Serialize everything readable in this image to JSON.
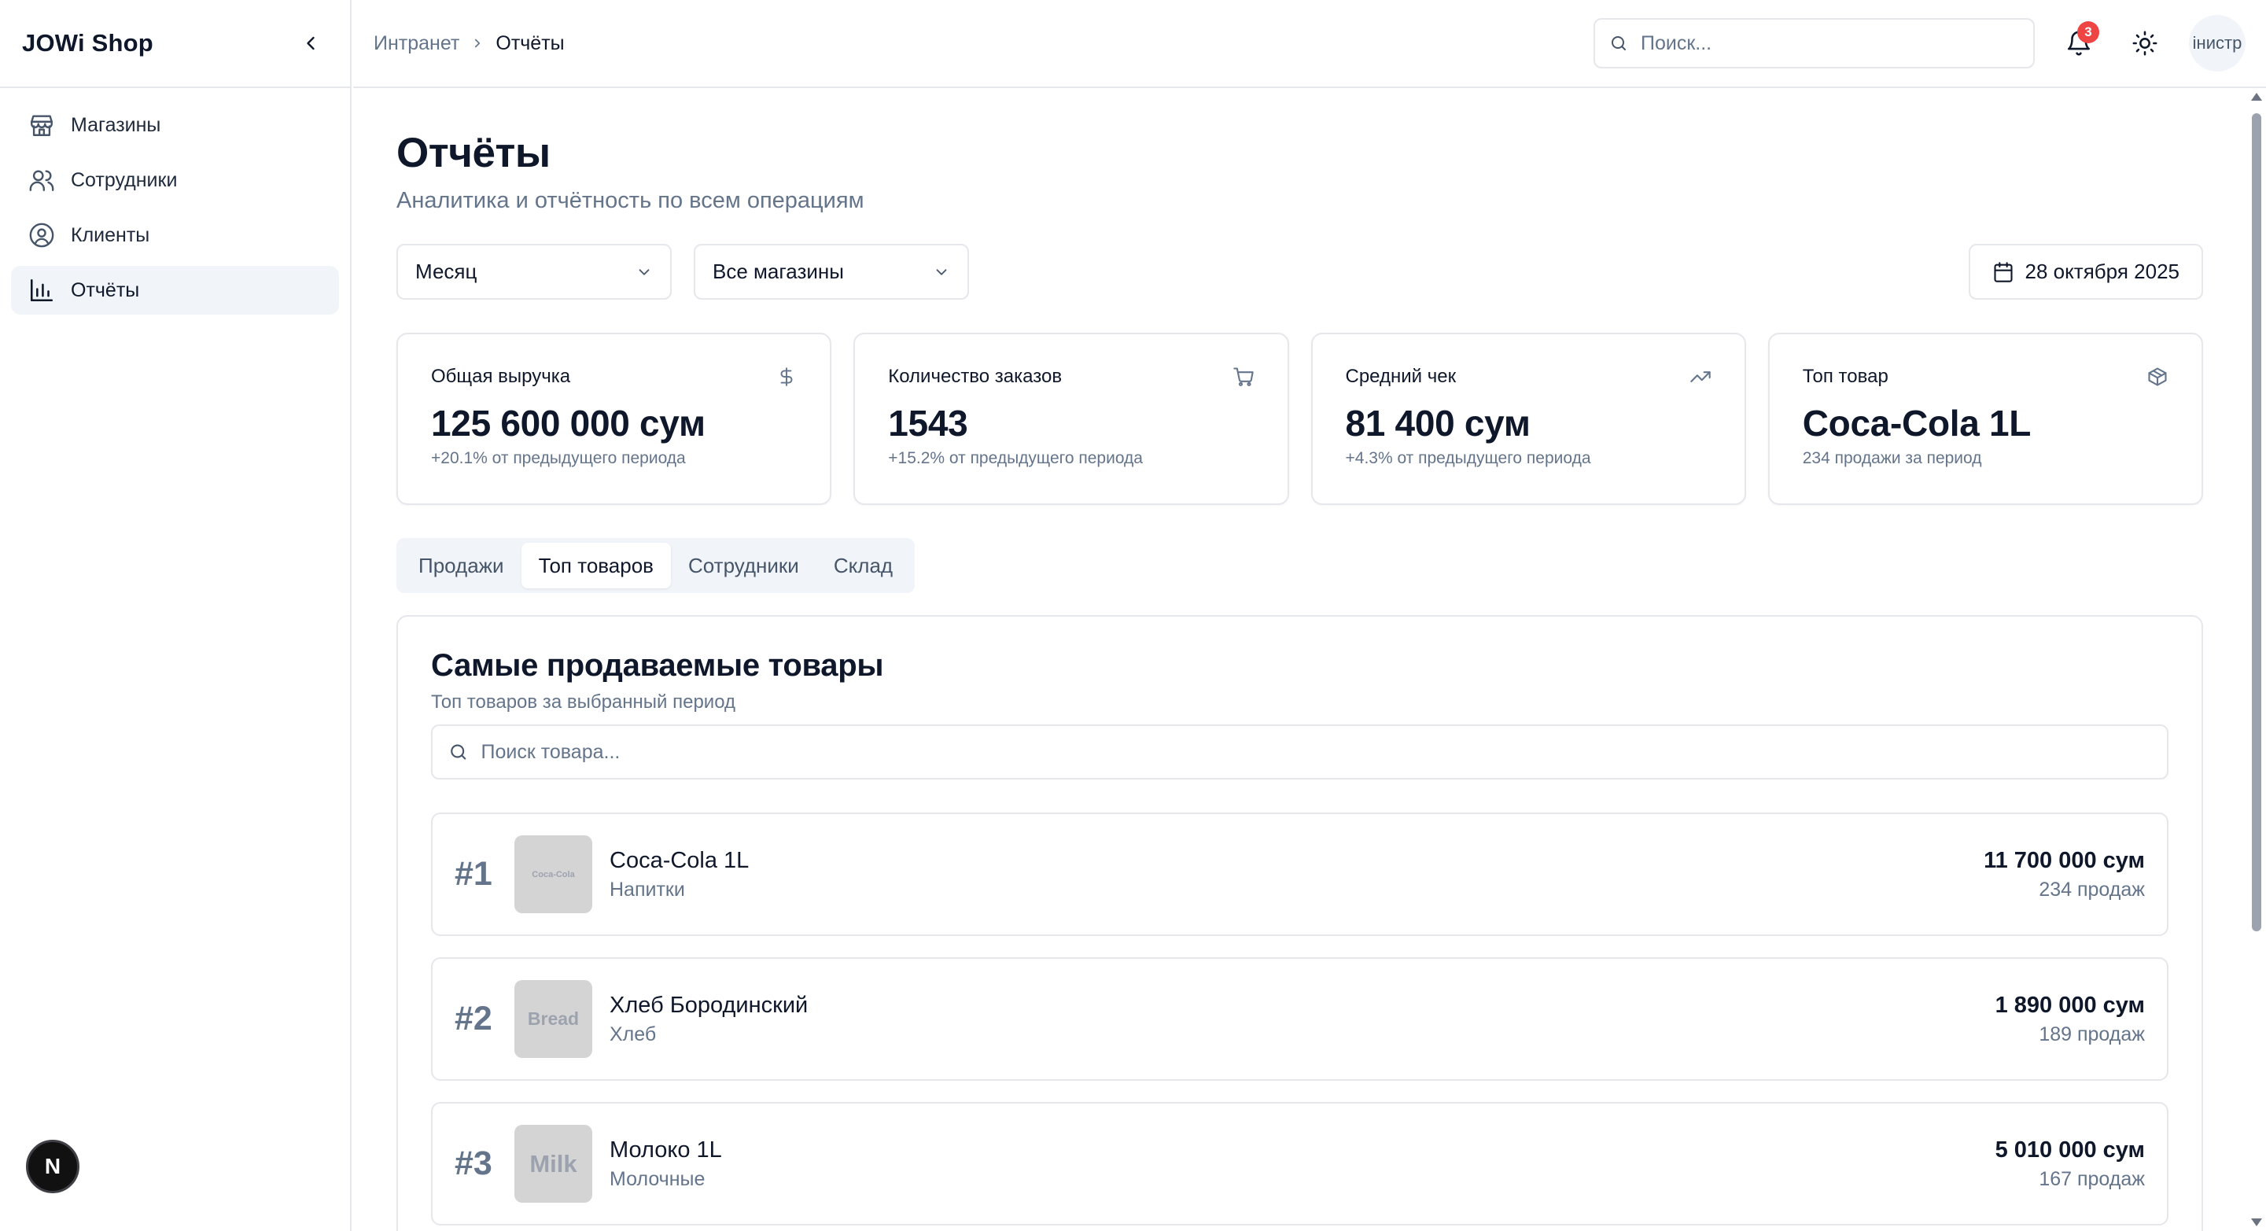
{
  "sidebar": {
    "brand": "JOWi Shop",
    "items": [
      {
        "label": "Магазины",
        "icon": "store-icon"
      },
      {
        "label": "Сотрудники",
        "icon": "users-icon"
      },
      {
        "label": "Клиенты",
        "icon": "user-circle-icon"
      },
      {
        "label": "Отчёты",
        "icon": "bar-chart-icon",
        "active": true
      }
    ],
    "badge_letter": "N"
  },
  "header": {
    "breadcrumb": {
      "parent": "Интранет",
      "current": "Отчёты"
    },
    "search_placeholder": "Поиск...",
    "notifications_count": "3",
    "avatar_text": "інистр"
  },
  "page": {
    "title": "Отчёты",
    "subtitle": "Аналитика и отчётность по всем операциям"
  },
  "filters": {
    "period": "Месяц",
    "store": "Все магазины",
    "date": "28 октября 2025"
  },
  "stats": [
    {
      "label": "Общая выручка",
      "value": "125 600 000 сум",
      "note": "+20.1% от предыдущего периода",
      "icon": "dollar-icon"
    },
    {
      "label": "Количество заказов",
      "value": "1543",
      "note": "+15.2% от предыдущего периода",
      "icon": "cart-icon"
    },
    {
      "label": "Средний чек",
      "value": "81 400 сум",
      "note": "+4.3% от предыдущего периода",
      "icon": "trending-up-icon"
    },
    {
      "label": "Топ товар",
      "value": "Coca-Cola 1L",
      "note": "234 продажи за период",
      "icon": "box-icon"
    }
  ],
  "tabs": [
    {
      "label": "Продажи"
    },
    {
      "label": "Топ товаров",
      "active": true
    },
    {
      "label": "Сотрудники"
    },
    {
      "label": "Склад"
    }
  ],
  "panel": {
    "title": "Самые продаваемые товары",
    "subtitle": "Топ товаров за выбранный период",
    "search_placeholder": "Поиск товара...",
    "products": [
      {
        "rank": "#1",
        "thumb_text": "Coca-Cola",
        "name": "Coca-Cola 1L",
        "category": "Напитки",
        "amount": "11 700 000 сум",
        "sales": "234 продаж"
      },
      {
        "rank": "#2",
        "thumb_text": "Bread",
        "name": "Хлеб Бородинский",
        "category": "Хлеб",
        "amount": "1 890 000 сум",
        "sales": "189 продаж"
      },
      {
        "rank": "#3",
        "thumb_text": "Milk",
        "name": "Молоко 1L",
        "category": "Молочные",
        "amount": "5 010 000 сум",
        "sales": "167 продаж"
      }
    ]
  }
}
